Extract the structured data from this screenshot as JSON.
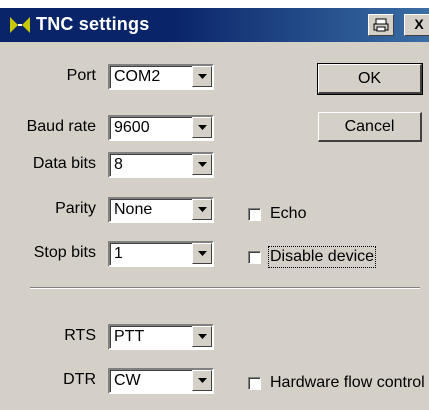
{
  "window": {
    "title": "TNC settings",
    "print_glyph": "⎙",
    "close_glyph": "X"
  },
  "port": {
    "label": "Port",
    "value": "COM2"
  },
  "baud": {
    "label": "Baud rate",
    "value": "9600"
  },
  "data_bits": {
    "label": "Data bits",
    "value": "8"
  },
  "parity": {
    "label": "Parity",
    "value": "None"
  },
  "stop_bits": {
    "label": "Stop bits",
    "value": "1"
  },
  "rts": {
    "label": "RTS",
    "value": "PTT"
  },
  "dtr": {
    "label": "DTR",
    "value": "CW"
  },
  "buttons": {
    "ok": "OK",
    "cancel": "Cancel"
  },
  "checks": {
    "echo": "Echo",
    "disable_device": "Disable device",
    "hw_flow": "Hardware flow control"
  },
  "colors": {
    "titlebar": "#0a246a",
    "face": "#d4d0c8",
    "accent_icon": "#c8c800"
  }
}
